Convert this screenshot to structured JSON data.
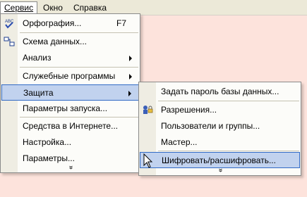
{
  "menubar": {
    "items": [
      {
        "label": "Сервис",
        "open": true
      },
      {
        "label": "Окно",
        "open": false
      },
      {
        "label": "Справка",
        "open": false
      }
    ]
  },
  "service_menu": {
    "items": [
      {
        "label": "Орфография...",
        "shortcut": "F7",
        "icon": "spellcheck-icon"
      },
      {
        "label": "Схема данных...",
        "icon": "relationships-icon"
      },
      {
        "label": "Анализ",
        "submenu": true
      },
      {
        "label": "Служебные программы",
        "submenu": true
      },
      {
        "label": "Защита",
        "submenu": true,
        "highlighted": true
      },
      {
        "label": "Параметры запуска..."
      },
      {
        "label": "Средства в Интернете..."
      },
      {
        "label": "Настройка..."
      },
      {
        "label": "Параметры..."
      }
    ],
    "expand": "»"
  },
  "security_submenu": {
    "items": [
      {
        "label": "Задать пароль базы данных..."
      },
      {
        "label": "Разрешения...",
        "icon": "permissions-icon"
      },
      {
        "label": "Пользователи и группы..."
      },
      {
        "label": "Мастер..."
      },
      {
        "label": "Шифровать/расшифровать...",
        "highlighted": true
      }
    ],
    "expand": "»"
  },
  "colors": {
    "highlight_fill": "#c1d2ee",
    "highlight_border": "#316ac5",
    "background": "#fde3dc"
  }
}
